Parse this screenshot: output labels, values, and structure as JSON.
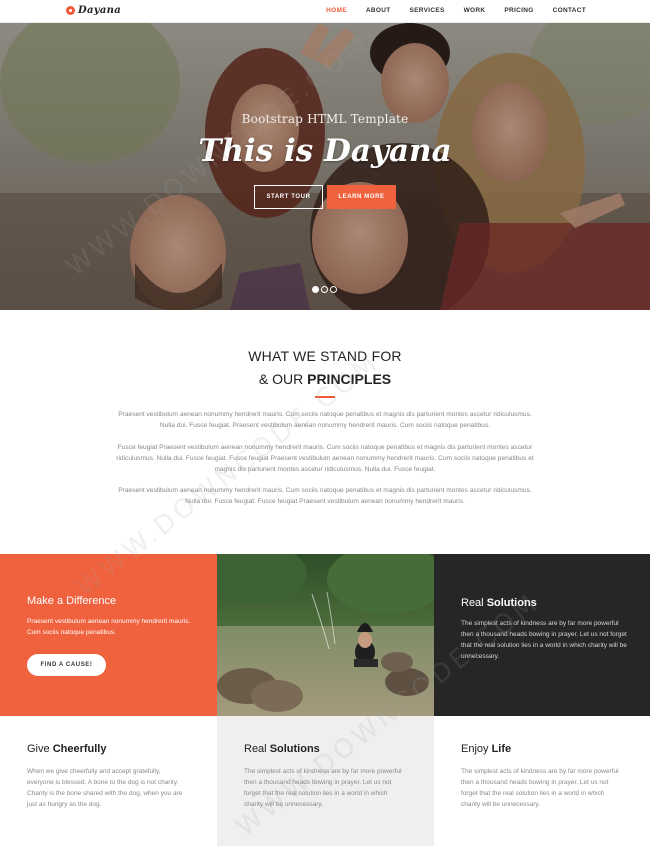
{
  "brand": {
    "logo_text": "Dayana",
    "accent": "#f05a3a"
  },
  "nav": {
    "items": [
      {
        "label": "HOME",
        "active": true
      },
      {
        "label": "ABOUT"
      },
      {
        "label": "SERVICES"
      },
      {
        "label": "WORK"
      },
      {
        "label": "PRICING"
      },
      {
        "label": "CONTACT"
      }
    ]
  },
  "hero": {
    "subtitle": "Bootstrap HTML Template",
    "title": "This is Dayana",
    "primary_button": "START TOUR",
    "secondary_button": "LEARN MORE",
    "slides": 3,
    "active_slide": 1
  },
  "principles": {
    "heading_line1": "WHAT WE STAND FOR",
    "heading_line2_prefix": "& OUR ",
    "heading_line2_bold": "PRINCIPLES",
    "paragraphs": [
      "Praesent vestibulum aenean nonummy hendrerit mauris. Cum sociis natoque penatibus et magnis dis parturient montes ascetur ridiculusmus. Nulla dui. Fusce feugiat. Praesent vestibulum aenean nonummy hendrerit mauris. Cum sociis natoque penatibus.",
      "Fusce feugiat Praesent vestibulum aenean nonummy hendrerit mauris. Cum sociis natoque penatibus et magnis dis parturient montes ascetur ridiculusmus. Nulla dui. Fusce feugiat. Fusce feugiat Praesent vestibulum aenean nonummy hendrerit mauris. Cum sociis natoque penatibus et magnis dis parturient montes ascetur ridiculusmus. Nulla dui. Fusce feugiat.",
      "Praesent vestibulum aenean nonummy hendrerit mauris. Cum sociis natoque penatibus et magnis dis parturient montes ascetur ridiculusmus. Nulla dui. Fusce feugiat. Fusce feugiat Praesent vestibulum aenean nonummy hendrerit mauris."
    ]
  },
  "difference": {
    "title": "Make a Difference",
    "text": "Praesent vestibulum aenean nonummy hendrerit mauris. Cum sociis natoque penatibus.",
    "button": "FIND A CAUSE!"
  },
  "real_solutions_dark": {
    "title_prefix": "Real ",
    "title_bold": "Solutions",
    "text": "The simplest acts of kindness are by far more powerful then a thousand heads bowing in prayer. Let us not forget that the real solution lies in a world in which charity will be unnecessary."
  },
  "columns": [
    {
      "title_prefix": "Give ",
      "title_bold": "Cheerfully",
      "text": "When we give cheerfully and accept gratefully, everyone is blessed. A bone to the dog is not charity. Charity is the bone shared with the dog, when you are just as hungry as the dog."
    },
    {
      "title_prefix": "Real ",
      "title_bold": "Solutions",
      "text": "The simplest acts of kindness are by far more powerful then a thousand heads bowing in prayer. Let us not forget that the real solution lies in a world in which charity will be unnecessary."
    },
    {
      "title_prefix": "Enjoy ",
      "title_bold": "Life",
      "text": "The simplest acts of kindness are by far more powerful then a thousand heads bowing in prayer. Let us not forget that the real solution lies in a world in which charity will be unnecessary."
    }
  ],
  "watermark": "WWW.DOWNCODE.COM"
}
